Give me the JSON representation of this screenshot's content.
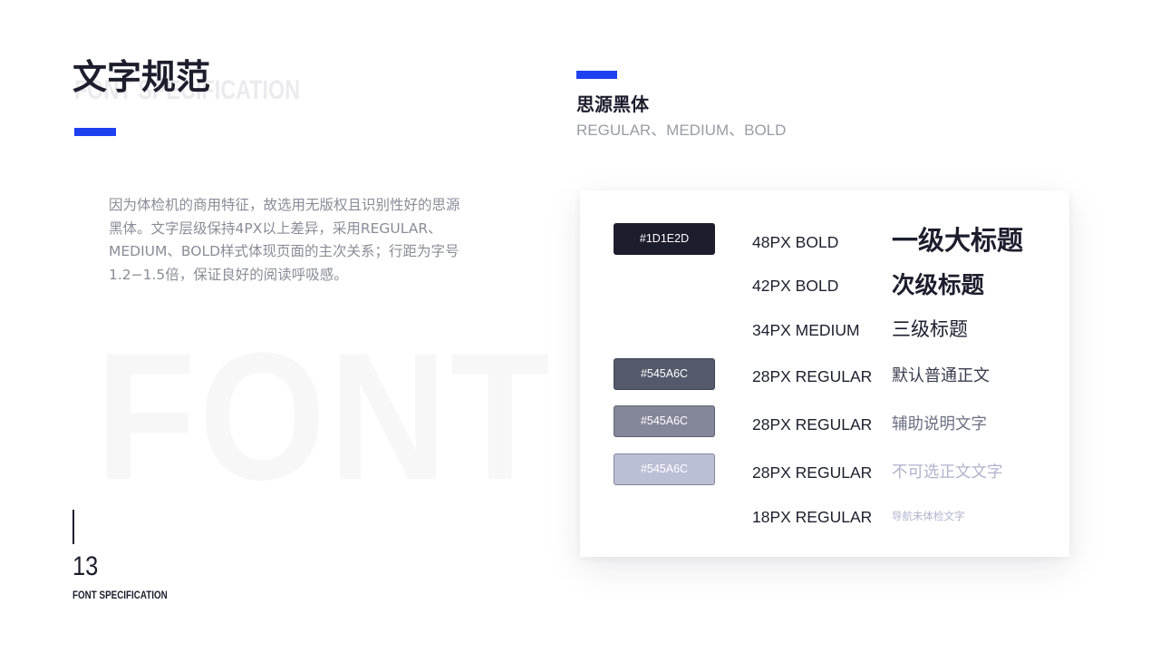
{
  "page": {
    "title": "文字规范",
    "title_bg_en": "FONT SPECIFICATION",
    "accent_color": "#1E40F0",
    "intro_lines": [
      "因为体检机的商用特征，故选用无版权且识别性好的思源",
      "黑体。文字层级保持4PX以上差异，采用REGULAR、",
      "MEDIUM、BOLD样式体现页面的主次关系；行距为字号",
      "1.2−1.5倍，保证良好的阅读呼吸感。"
    ],
    "bg_word": "FONT",
    "page_number": "13",
    "page_caption": "FONT SPECIFICATION"
  },
  "font_info": {
    "name": "思源黑体",
    "weights": "REGULAR、MEDIUM、BOLD"
  },
  "swatches": [
    {
      "label": "#1D1E2D",
      "color": "#1D1E2D",
      "text_color": "#ffffff"
    },
    {
      "label": "#545A6C",
      "color": "#545A6C",
      "text_color": "#ffffff"
    },
    {
      "label": "#545A6C",
      "color": "#84879A",
      "text_color": "#ffffff"
    },
    {
      "label": "#545A6C",
      "color": "#BABFD6",
      "text_color": "#ffffff"
    }
  ],
  "specs": [
    {
      "label": "48PX BOLD",
      "sample": "一级大标题",
      "color": "#1D1E2D",
      "weight": "bold"
    },
    {
      "label": "42PX BOLD",
      "sample": "次级标题",
      "color": "#1D1E2D",
      "weight": "bold"
    },
    {
      "label": "34PX MEDIUM",
      "sample": "三级标题",
      "color": "#1D1E2D",
      "weight": "medium"
    },
    {
      "label": "28PX REGULAR",
      "sample": "默认普通正文",
      "color": "#3a3d4e",
      "weight": "regular"
    },
    {
      "label": "28PX REGULAR",
      "sample": "辅助说明文字",
      "color": "#6b6f82",
      "weight": "regular"
    },
    {
      "label": "28PX REGULAR",
      "sample": "不可选正文文字",
      "color": "#aeb3cc",
      "weight": "regular"
    },
    {
      "label": "18PX REGULAR",
      "sample": "导航未体检文字",
      "color": "#aeb3cc",
      "weight": "regular"
    }
  ]
}
